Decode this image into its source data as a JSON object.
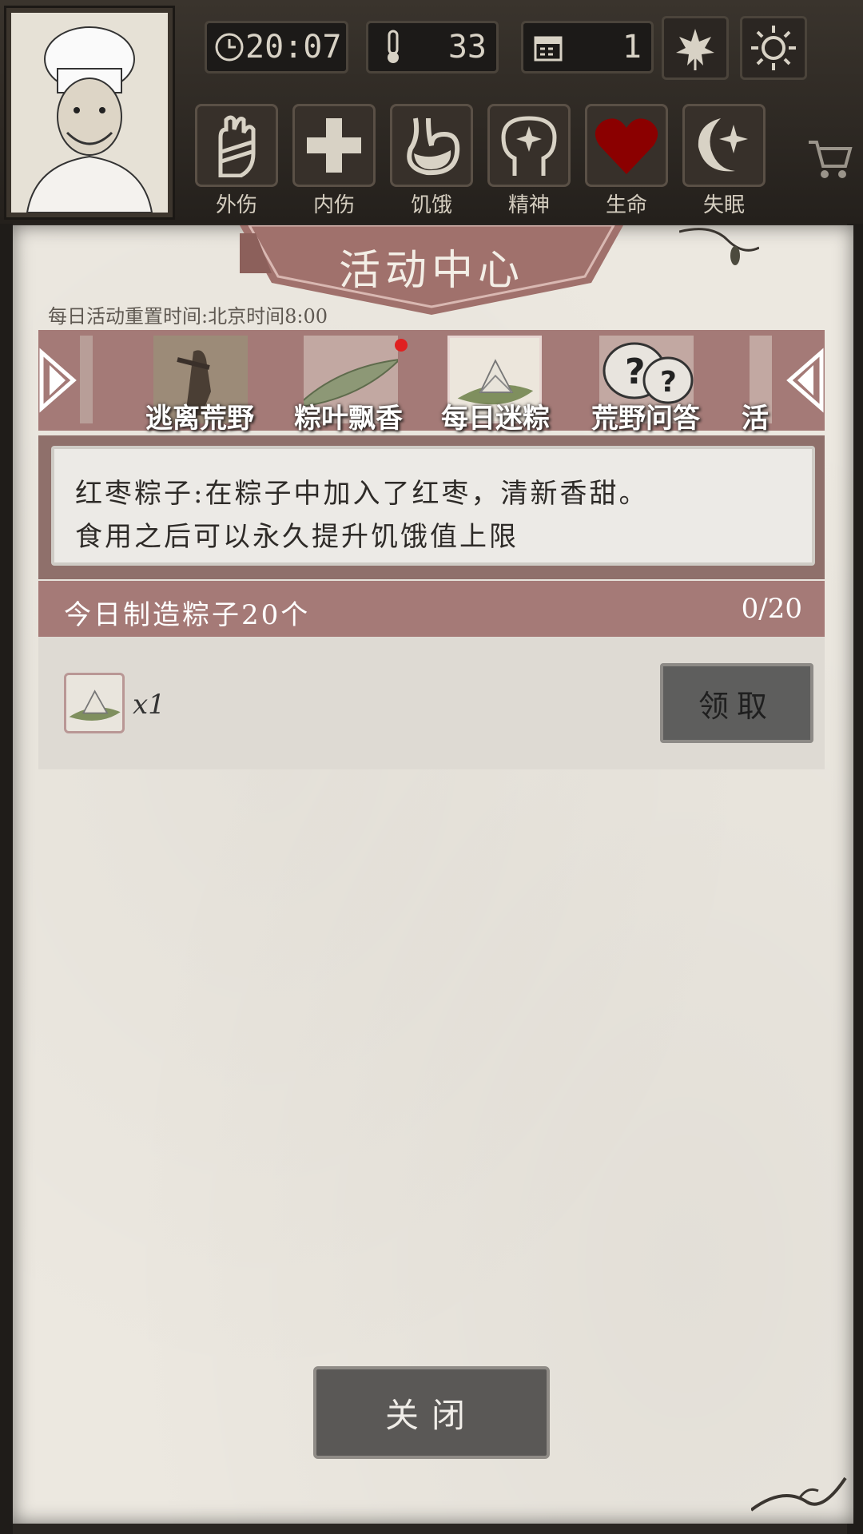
{
  "hud": {
    "time": "20:07",
    "temperature": "33",
    "day": "1",
    "season_icon": "maple-leaf-icon",
    "weather_icon": "sun-icon"
  },
  "statuses": [
    {
      "label": "外伤",
      "icon": "hand-bandage-icon",
      "color": "#d8d2c5"
    },
    {
      "label": "内伤",
      "icon": "cross-icon",
      "color": "#d8d2c5"
    },
    {
      "label": "饥饿",
      "icon": "stomach-icon",
      "color": "#d8d2c5"
    },
    {
      "label": "精神",
      "icon": "head-sparkle-icon",
      "color": "#d8d2c5"
    },
    {
      "label": "生命",
      "icon": "heart-icon",
      "color": "#8b0000"
    },
    {
      "label": "失眠",
      "icon": "moon-star-icon",
      "color": "#d8d2c5"
    }
  ],
  "panel": {
    "title": "活动中心",
    "reset_note": "每日活动重置时间:北京时间8:00",
    "tabs": [
      {
        "label": "逃离荒野",
        "badge": false
      },
      {
        "label": "粽叶飘香",
        "badge": true
      },
      {
        "label": "每日迷粽",
        "badge": false,
        "selected": true
      },
      {
        "label": "荒野问答",
        "badge": false
      },
      {
        "label": "活",
        "badge": false
      }
    ],
    "description": {
      "line1": "红枣粽子:在粽子中加入了红枣，清新香甜。",
      "line2": "食用之后可以永久提升饥饿值上限"
    },
    "task": {
      "text": "今日制造粽子20个",
      "progress": "0/20"
    },
    "reward": {
      "icon": "zongzi-icon",
      "qty": "x1"
    },
    "claim_label": "领取",
    "close_label": "关闭"
  },
  "colors": {
    "accent": "#a57a77",
    "badge": "#e02020",
    "heart": "#8b0000"
  }
}
